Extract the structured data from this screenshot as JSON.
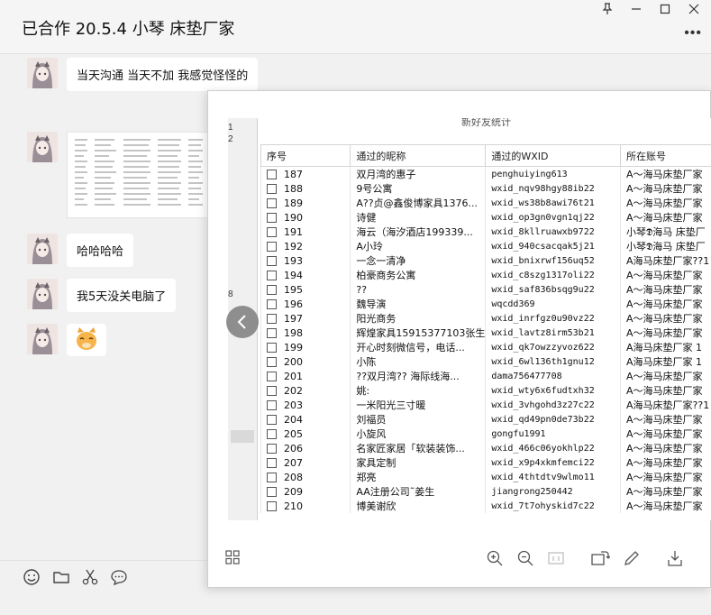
{
  "window": {
    "title": "已合作 20.5.4 小琴 床垫厂家",
    "pin_glyph": "⊥",
    "min_glyph": "—",
    "max_glyph": "☐",
    "close_glyph": "✕",
    "more_glyph": "•••"
  },
  "messages": [
    {
      "type": "text",
      "text": "当天沟通  当天不加  我感觉怪怪的"
    },
    {
      "type": "image"
    },
    {
      "type": "text",
      "text": "哈哈哈哈"
    },
    {
      "type": "text",
      "text": "我5天没关电脑了"
    },
    {
      "type": "emoji",
      "icon": "cat-emoji-icon"
    }
  ],
  "viewer": {
    "heading_fragment": "新好友统计",
    "row_numbers": [
      "1",
      "2",
      "8"
    ],
    "prev_glyph": "‹",
    "columns": [
      "序号",
      "通过的昵称",
      "通过的WXID",
      "所在账号"
    ],
    "rows": [
      [
        "187",
        "双月湾的惠子",
        "penghuiying613",
        "A～海马床垫厂家"
      ],
      [
        "188",
        "9号公寓",
        "wxid_nqv98hgy88ib22",
        "A～海马床垫厂家"
      ],
      [
        "189",
        "A??贞@鑫俊博家具1376...",
        "wxid_ws38b8awi76t21",
        "A～海马床垫厂家"
      ],
      [
        "190",
        "诗健",
        "wxid_op3gn0vgn1qj22",
        "A～海马床垫厂家"
      ],
      [
        "191",
        "海云（海汐酒店199339...",
        "wxid_8kllruawxb9722",
        "小琴𝕯海马 床垫厂"
      ],
      [
        "192",
        "A小玲",
        "wxid_940csacqak5j21",
        "小琴𝕯海马 床垫厂"
      ],
      [
        "193",
        "一念一清净",
        "wxid_bnixrwf156uq52",
        "A海马床垫厂家??1"
      ],
      [
        "194",
        "柏豪商务公寓",
        "wxid_c8szg1317oli22",
        "A～海马床垫厂家"
      ],
      [
        "195",
        "??",
        "wxid_saf836bsqg9u22",
        "A～海马床垫厂家"
      ],
      [
        "196",
        "魏导演",
        "wqcdd369",
        "A～海马床垫厂家"
      ],
      [
        "197",
        "阳光商务",
        "wxid_inrfgz0u90vz22",
        "A～海马床垫厂家"
      ],
      [
        "198",
        "辉煌家具15915377103张生",
        "wxid_lavtz8irm53b21",
        "A～海马床垫厂家"
      ],
      [
        "199",
        "开心时刻微信号，电话...",
        "wxid_qk7owzzyvoz622",
        "A海马床垫厂家  1"
      ],
      [
        "200",
        "小陈",
        "wxid_6wl136th1gnu12",
        "A海马床垫厂家  1"
      ],
      [
        "201",
        "??双月湾?? 海际线海...",
        "dama756477708",
        "A～海马床垫厂家"
      ],
      [
        "202",
        "姚:",
        "wxid_wty6x6fudtxh32",
        "A～海马床垫厂家"
      ],
      [
        "203",
        "一米阳光三寸暖",
        "wxid_3vhgohd3z27c22",
        "A海马床垫厂家??1"
      ],
      [
        "204",
        "刘福员",
        "wxid_qd49pn0de73b22",
        "A～海马床垫厂家"
      ],
      [
        "205",
        "小旋风",
        "gongfu1991",
        "A～海马床垫厂家"
      ],
      [
        "206",
        "名家匠家居「软装装饰...",
        "wxid_466c06yokhlp22",
        "A～海马床垫厂家"
      ],
      [
        "207",
        "家具定制",
        "wxid_x9p4xkmfemci22",
        "A～海马床垫厂家"
      ],
      [
        "208",
        "郑亮",
        "wxid_4thtdtv9wlmo11",
        "A～海马床垫厂家"
      ],
      [
        "209",
        "AA注册公司˜姜生",
        "jiangrong250442",
        "A～海马床垫厂家"
      ],
      [
        "210",
        "博美谢欣",
        "wxid_7t7ohyskid7c22",
        "A～海马床垫厂家"
      ]
    ],
    "toolbar_icons": [
      "grid-icon",
      "zoom-in-icon",
      "zoom-out-icon",
      "actual-size-icon",
      "rotate-icon",
      "edit-icon",
      "download-icon"
    ]
  },
  "input_icons": [
    "emoji-icon",
    "folder-icon",
    "scissors-icon",
    "chat-bubble-icon"
  ]
}
